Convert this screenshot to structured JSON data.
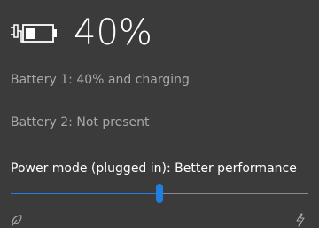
{
  "battery": {
    "icon": "battery-charging-icon",
    "percent_label": "40%",
    "level": 0.4
  },
  "details": {
    "battery1": "Battery 1: 40% and charging",
    "battery2": "Battery 2: Not present"
  },
  "power_mode": {
    "label": "Power mode (plugged in): Better performance",
    "value": 0.5,
    "left_icon": "leaf-icon",
    "right_icon": "lightning-icon"
  },
  "colors": {
    "accent": "#1f7fe0",
    "background": "#3b3b3b",
    "secondary_text": "#a8a8a8"
  }
}
